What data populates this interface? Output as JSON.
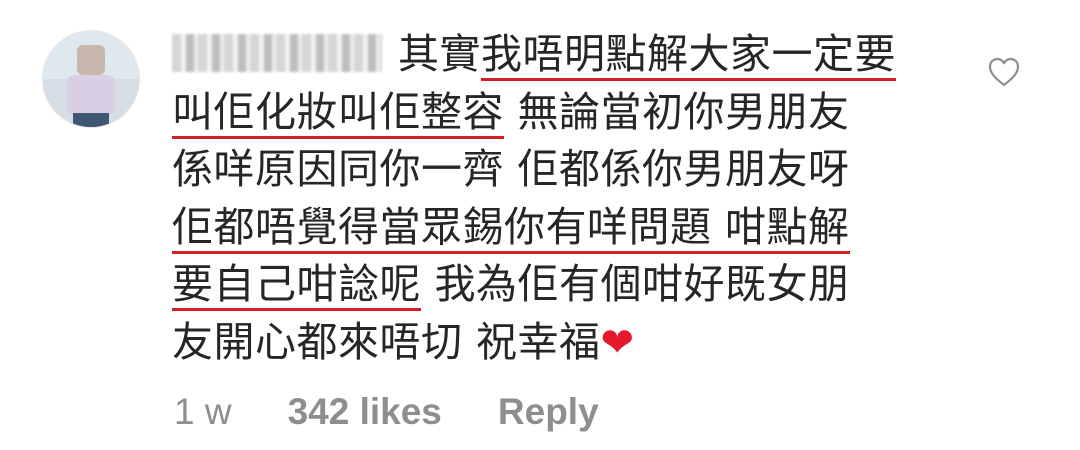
{
  "comment": {
    "lines": [
      [
        {
          "t": "其實",
          "u": false
        },
        {
          "t": "我唔明點解大家一定要",
          "u": true
        }
      ],
      [
        {
          "t": "叫佢化妝叫佢整容",
          "u": true
        },
        {
          "t": " 無論當初你男朋友",
          "u": false
        }
      ],
      [
        {
          "t": "係咩原因同你一齊 佢都係你男朋友呀",
          "u": false
        }
      ],
      [
        {
          "t": "佢都唔覺得當眾錫你有咩問題 咁點解",
          "u": true
        }
      ],
      [
        {
          "t": "要自己咁諗呢",
          "u": true
        },
        {
          "t": " 我為佢有個咁好既女朋",
          "u": false
        }
      ],
      [
        {
          "t": "友開心都來唔切 祝幸福",
          "u": false
        },
        {
          "t": "❤",
          "u": false,
          "emoji": true
        }
      ]
    ]
  },
  "meta": {
    "time": "1 w",
    "likes": "342 likes",
    "reply": "Reply"
  },
  "icons": {
    "like": "heart-outline-icon"
  },
  "colors": {
    "underline": "#d21f27",
    "text": "#262626",
    "meta": "#8e8e8e"
  }
}
